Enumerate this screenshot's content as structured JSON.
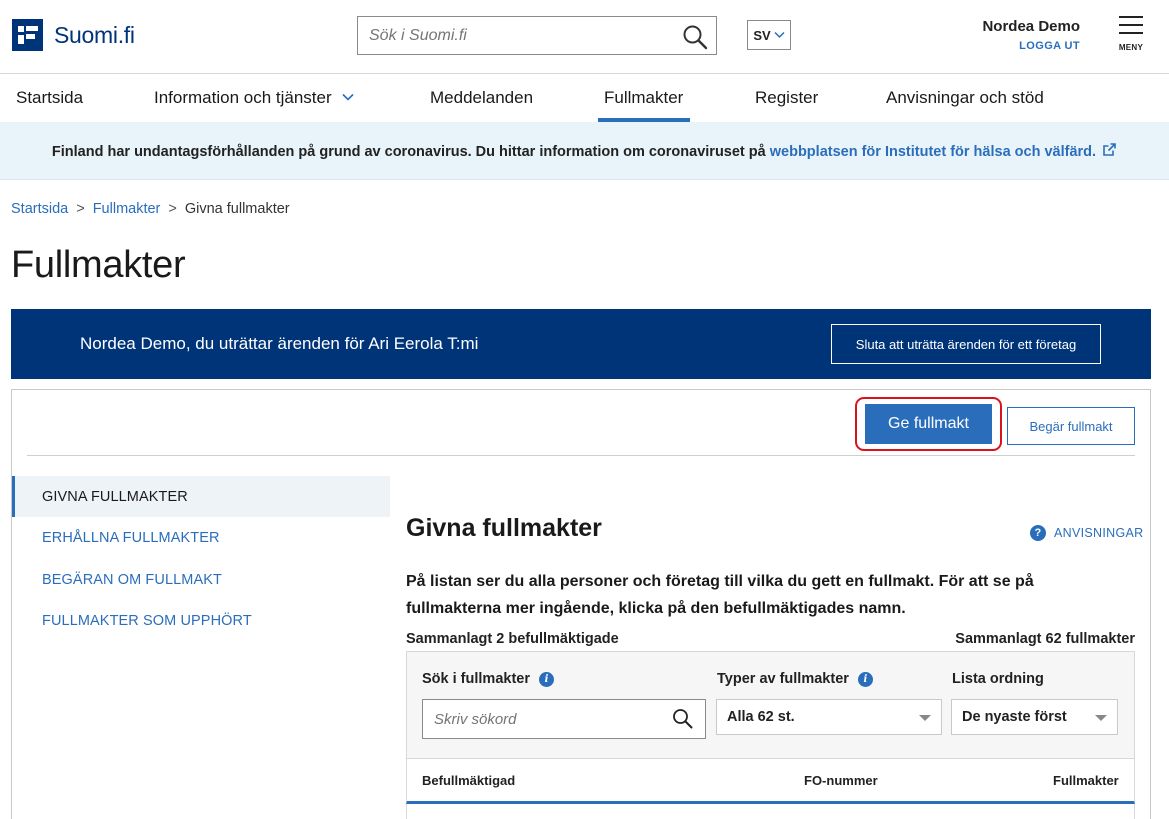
{
  "header": {
    "logo_text": "Suomi.fi",
    "search_placeholder": "Sök i Suomi.fi",
    "language": "SV",
    "user_name": "Nordea Demo",
    "logout_label": "LOGGA UT",
    "menu_label": "MENY"
  },
  "nav": {
    "items": [
      {
        "label": "Startsida"
      },
      {
        "label": "Information och tjänster"
      },
      {
        "label": "Meddelanden"
      },
      {
        "label": "Fullmakter"
      },
      {
        "label": "Register"
      },
      {
        "label": "Anvisningar och stöd"
      }
    ],
    "active": "Fullmakter"
  },
  "banner": {
    "text": "Finland har undantagsförhållanden på grund av coronavirus. Du hittar information om coronaviruset på",
    "link": "webbplatsen för Institutet för hälsa och välfärd."
  },
  "breadcrumb": {
    "items": [
      "Startsida",
      "Fullmakter"
    ],
    "separator": ">",
    "current": "Givna fullmakter"
  },
  "page": {
    "title": "Fullmakter"
  },
  "acting": {
    "text": "Nordea Demo, du uträttar ärenden för Ari Eerola T:mi",
    "stop_button": "Sluta att uträtta ärenden för ett företag"
  },
  "actions": {
    "give_button": "Ge fullmakt",
    "request_button": "Begär fullmakt"
  },
  "side_menu": {
    "items": [
      {
        "label": "GIVNA FULLMAKTER"
      },
      {
        "label": "ERHÅLLNA FULLMAKTER"
      },
      {
        "label": "BEGÄRAN OM FULLMAKT"
      },
      {
        "label": "FULLMAKTER SOM UPPHÖRT"
      }
    ],
    "active_index": 0
  },
  "content": {
    "title": "Givna fullmakter",
    "help_label": "ANVISNINGAR",
    "intro": "På listan ser du alla personer och företag till vilka du gett en fullmakt. För att se på fullmakterna mer ingående, klicka på den befullmäktigades namn.",
    "count_left": "Sammanlagt 2 befullmäktigade",
    "count_right": "Sammanlagt 62 fullmakter"
  },
  "filters": {
    "search_label": "Sök i fullmakter",
    "search_placeholder": "Skriv sökord",
    "types_label": "Typer av fullmakter",
    "types_value": "Alla 62 st.",
    "order_label": "Lista ordning",
    "order_value": "De nyaste först"
  },
  "table": {
    "columns": [
      "Befullmäktigad",
      "FO-nummer",
      "Fullmakter"
    ]
  },
  "colors": {
    "brand": "#003479",
    "accent": "#2a6ebb",
    "highlight": "#d8141a",
    "banner_bg": "#e9f4fa"
  }
}
